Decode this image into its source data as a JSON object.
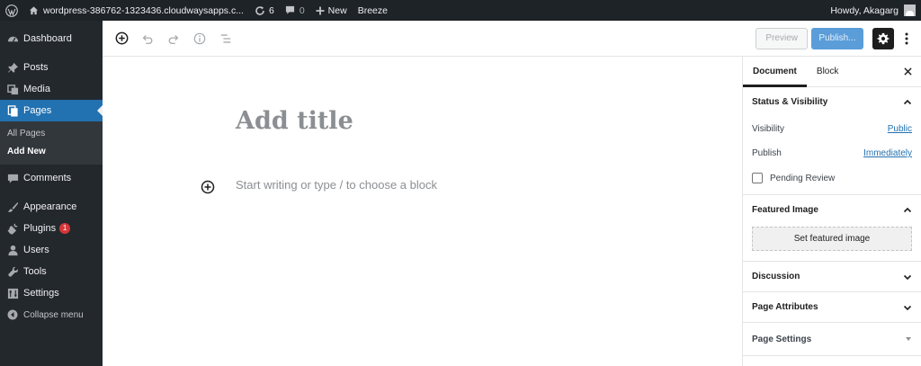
{
  "adminbar": {
    "site_name": "wordpress-386762-1323436.cloudwaysapps.c...",
    "updates_count": "6",
    "comments_count": "0",
    "new_label": "New",
    "breeze_label": "Breeze",
    "howdy": "Howdy, Akagarg"
  },
  "sidebar": {
    "dashboard": "Dashboard",
    "posts": "Posts",
    "media": "Media",
    "pages": "Pages",
    "pages_sub": [
      "All Pages",
      "Add New"
    ],
    "comments": "Comments",
    "appearance": "Appearance",
    "plugins": "Plugins",
    "plugins_badge": "1",
    "users": "Users",
    "tools": "Tools",
    "settings": "Settings",
    "collapse": "Collapse menu"
  },
  "header": {
    "preview": "Preview",
    "publish": "Publish..."
  },
  "editor": {
    "title_placeholder": "Add title",
    "block_placeholder": "Start writing or type / to choose a block"
  },
  "panel": {
    "tabs": [
      "Document",
      "Block"
    ],
    "status_visibility": {
      "title": "Status & Visibility",
      "visibility_label": "Visibility",
      "visibility_value": "Public",
      "publish_label": "Publish",
      "publish_value": "Immediately",
      "pending_review": "Pending Review"
    },
    "featured_image": {
      "title": "Featured Image",
      "button": "Set featured image"
    },
    "discussion": "Discussion",
    "page_attributes": "Page Attributes",
    "page_settings": "Page Settings"
  },
  "colors": {
    "admin_bar": "#1d2327",
    "sidebar": "#23282d",
    "active_menu": "#2271b1",
    "publish_button": "#5b9dd9",
    "link": "#2271b1"
  }
}
